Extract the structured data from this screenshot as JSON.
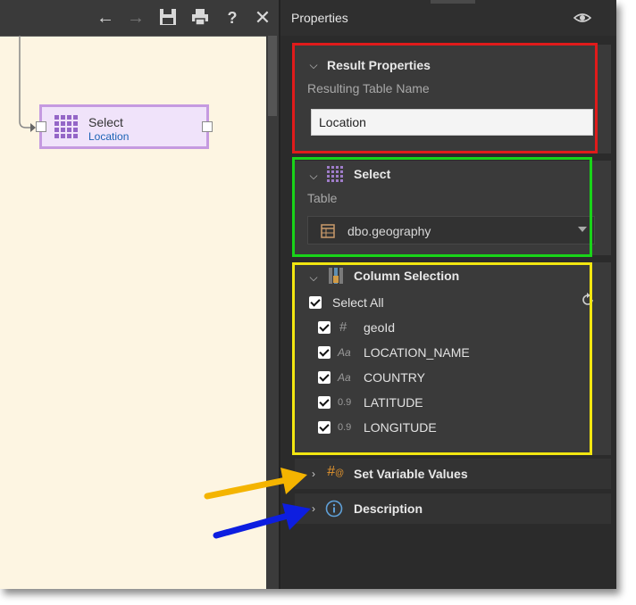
{
  "panel": {
    "title": "Properties"
  },
  "node": {
    "title": "Select",
    "subtitle": "Location"
  },
  "result_properties": {
    "header": "Result Properties",
    "table_name_label": "Resulting Table Name",
    "table_name_value": "Location"
  },
  "select_section": {
    "header": "Select",
    "table_label": "Table",
    "table_value": "dbo.geography"
  },
  "column_selection": {
    "header": "Column Selection",
    "select_all": "Select All",
    "columns": [
      {
        "type": "#",
        "name": "geoId"
      },
      {
        "type": "Aa",
        "name": "LOCATION_NAME"
      },
      {
        "type": "Aa",
        "name": "COUNTRY"
      },
      {
        "type": "0.9",
        "name": "LATITUDE"
      },
      {
        "type": "0.9",
        "name": "LONGITUDE"
      }
    ]
  },
  "set_variable_values": {
    "header": "Set Variable Values"
  },
  "description": {
    "header": "Description"
  },
  "colors": {
    "red_outline": "#e01b1b",
    "green_outline": "#19d419",
    "yellow_outline": "#f2e611",
    "orange_arrow": "#f4b400",
    "blue_arrow": "#0d1ee0"
  }
}
